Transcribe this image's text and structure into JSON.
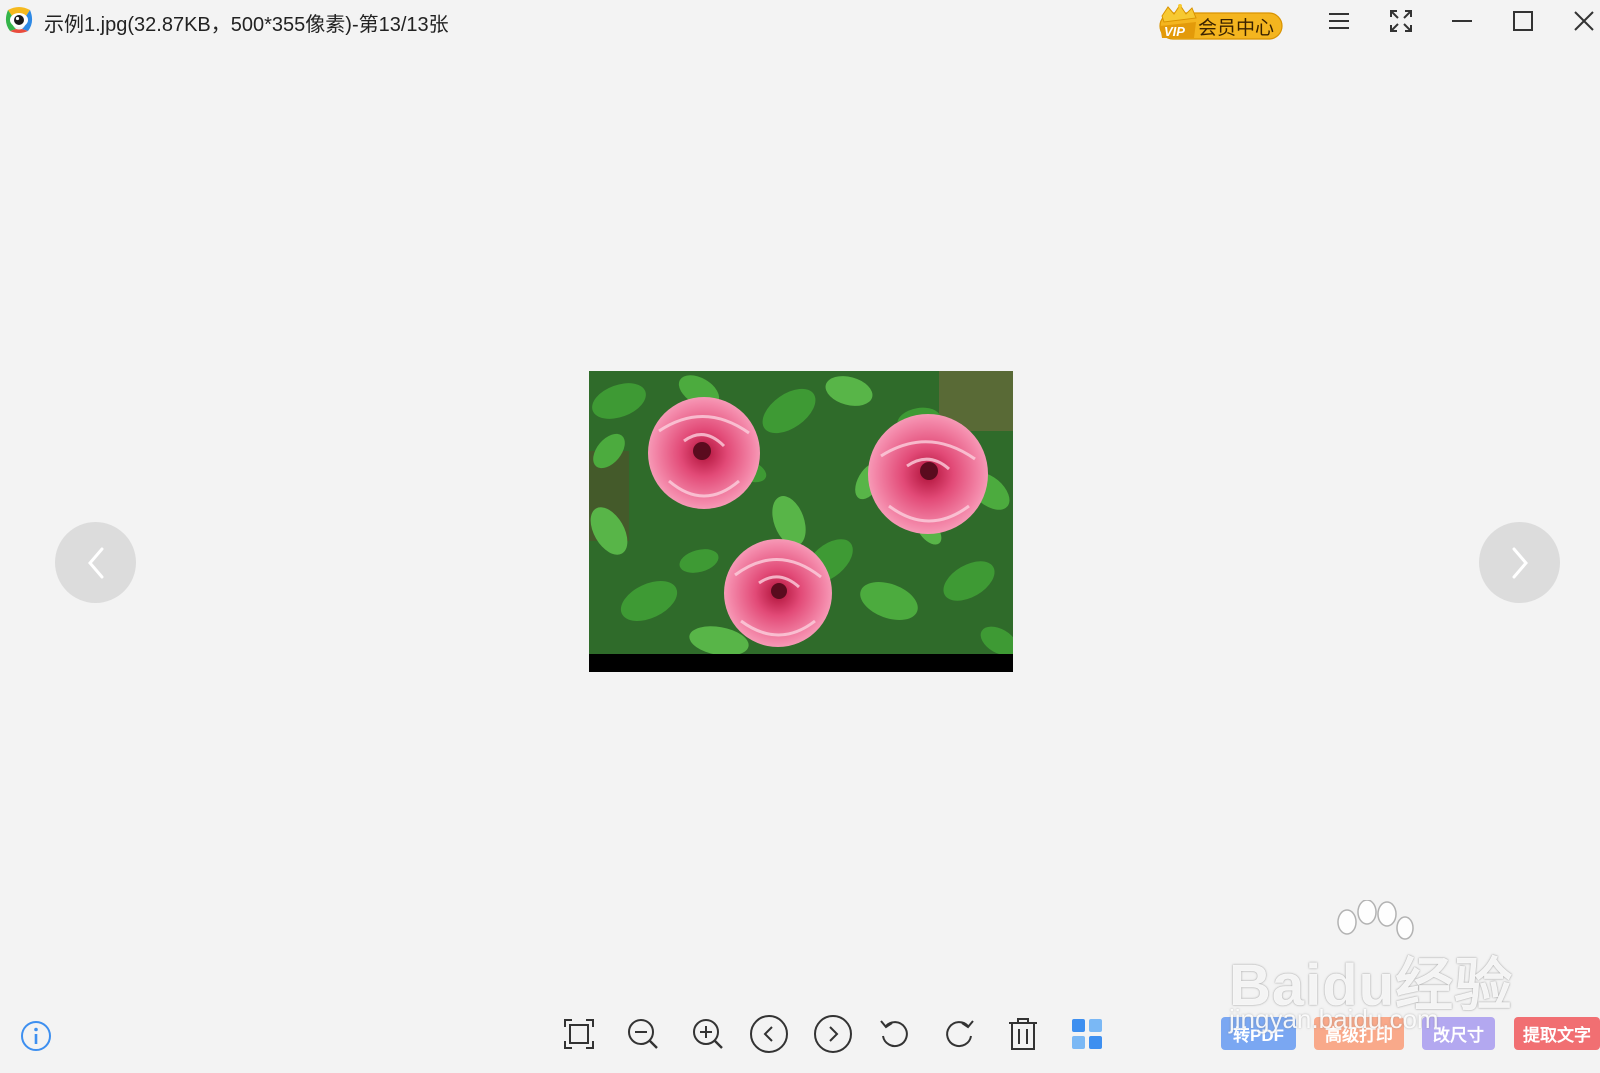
{
  "window": {
    "title": "示例1.jpg(32.87KB，500*355像素)-第13/13张"
  },
  "header": {
    "vip_label": "会员中心",
    "vip_badge": "VIP"
  },
  "features": {
    "to_pdf": "转PDF",
    "advanced_print": "高级打印",
    "resize": "改尺寸",
    "extract_text": "提取文字"
  },
  "watermark": {
    "brand": "Baidu经验",
    "url": "jingyan.baidu.com"
  },
  "colors": {
    "background": "#f3f3f3",
    "vip_gold": "#f4b51f",
    "to_pdf": "#7aa7f2",
    "advanced_print": "#f9a98a",
    "resize": "#b3a8f0",
    "extract_text": "#f16f72",
    "accent_blue": "#3d8ff0"
  },
  "icons": {
    "app": "eye-logo-icon",
    "menu": "hamburger-menu-icon",
    "fullscreen": "fullscreen-icon",
    "minimize": "minimize-icon",
    "maximize": "maximize-icon",
    "close": "close-icon",
    "prev": "chevron-left-icon",
    "next": "chevron-right-icon",
    "fit": "fit-to-window-icon",
    "zoom_out": "zoom-out-icon",
    "zoom_in": "zoom-in-icon",
    "rotate_left": "rotate-left-icon",
    "rotate_right": "rotate-right-icon",
    "delete": "trash-icon",
    "thumbnails": "thumbnail-grid-icon",
    "info": "info-icon"
  }
}
